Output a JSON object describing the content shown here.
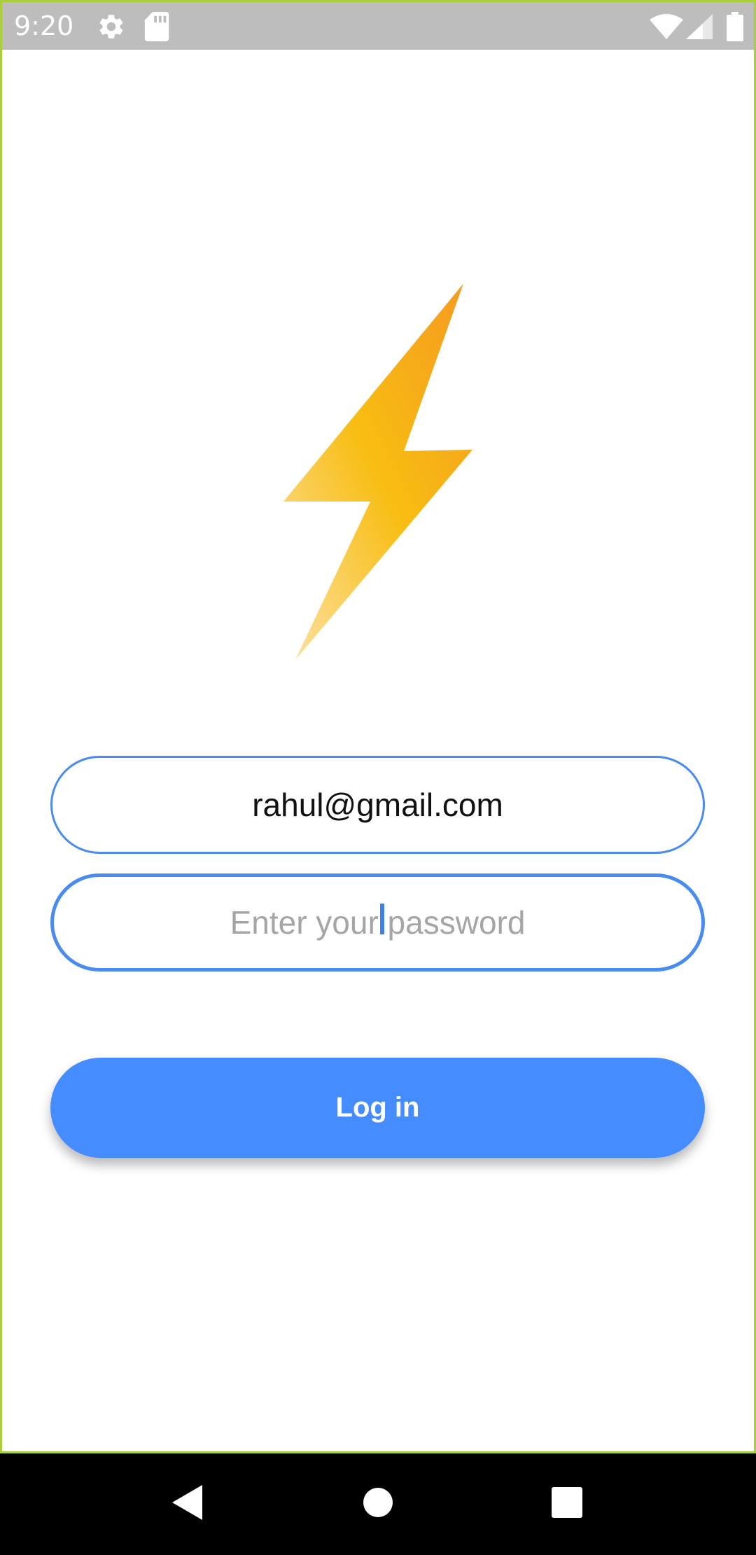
{
  "status_bar": {
    "time": "9:20",
    "icons": [
      "settings-icon",
      "sd-card-icon",
      "wifi-icon",
      "cell-signal-icon",
      "battery-icon"
    ]
  },
  "logo": {
    "icon": "lightning-bolt-icon",
    "colors": [
      "#f6a21e",
      "#f9c10f",
      "#fbd98c"
    ]
  },
  "form": {
    "email_value": "rahul@gmail.com",
    "password_placeholder": "Enter your password",
    "login_label": "Log in"
  },
  "nav_bar": {
    "buttons": [
      "back-icon",
      "home-icon",
      "recents-icon"
    ]
  },
  "colors": {
    "accent": "#448cff",
    "status_bar": "#bdbdbd",
    "frame_border": "#a8cf3a"
  }
}
